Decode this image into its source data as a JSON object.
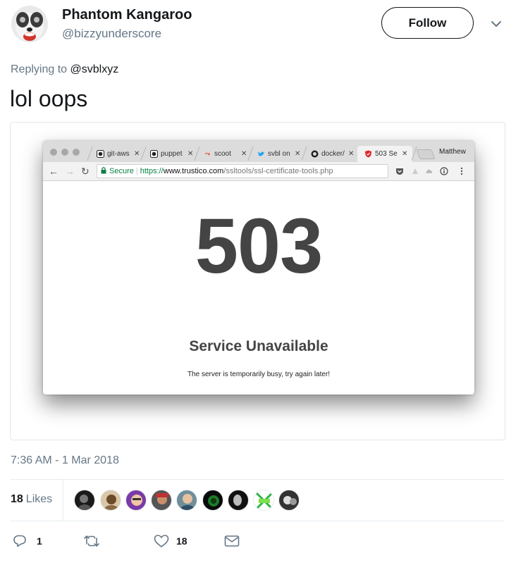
{
  "author": {
    "name": "Phantom Kangaroo",
    "handle": "@bizzyunderscore"
  },
  "follow_label": "Follow",
  "reply_context": {
    "prefix": "Replying to",
    "mention": "@svblxyz"
  },
  "tweet_text": "lol oops",
  "screenshot": {
    "tabs": [
      {
        "label": "git-aws",
        "icon": "github-icon"
      },
      {
        "label": "puppet",
        "icon": "github-icon"
      },
      {
        "label": "scoot",
        "icon": "scoot-icon"
      },
      {
        "label": "svbl on",
        "icon": "twitter-bird-icon"
      },
      {
        "label": "docker/",
        "icon": "github-icon"
      },
      {
        "label": "503 Se",
        "icon": "shield-icon",
        "active": true
      }
    ],
    "profile_name": "Matthew",
    "omnibox": {
      "secure_label": "Secure",
      "url_scheme": "https://",
      "url_host": "www.trustico.com",
      "url_path": "/ssltools/ssl-certificate-tools.php"
    },
    "error_code": "503",
    "error_title": "Service Unavailable",
    "error_desc": "The server is temporarily busy, try again later!"
  },
  "timestamp": "7:36 AM - 1 Mar 2018",
  "likes": {
    "count": "18",
    "label": "Likes"
  },
  "actions": {
    "replies": "1",
    "likes": "18"
  },
  "colors": {
    "text": "#14171a",
    "muted": "#657786",
    "divider": "#e6ecf0",
    "secure_green": "#0b8043",
    "error_gray": "#444444"
  }
}
